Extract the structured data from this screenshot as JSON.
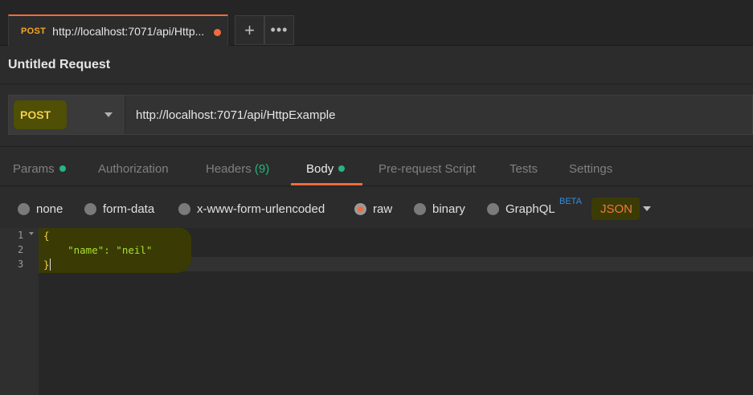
{
  "tab": {
    "method": "POST",
    "title": "http://localhost:7071/api/Http..."
  },
  "request_name": "Untitled Request",
  "url_bar": {
    "method": "POST",
    "url": "http://localhost:7071/api/HttpExample"
  },
  "section_tabs": [
    {
      "label": "Params"
    },
    {
      "label": "Authorization"
    },
    {
      "label": "Headers",
      "count": "(9)"
    },
    {
      "label": "Body"
    },
    {
      "label": "Pre-request Script"
    },
    {
      "label": "Tests"
    },
    {
      "label": "Settings"
    }
  ],
  "body_types": [
    {
      "label": "none"
    },
    {
      "label": "form-data"
    },
    {
      "label": "x-www-form-urlencoded"
    },
    {
      "label": "raw"
    },
    {
      "label": "binary"
    },
    {
      "label": "GraphQL"
    }
  ],
  "graphql_badge": "BETA",
  "raw_format": "JSON",
  "editor": {
    "line_numbers": [
      "1",
      "2",
      "3"
    ],
    "lines": [
      "{",
      "    \"name\": \"neil\"",
      "}"
    ]
  },
  "icons": {
    "new_tab": "plus-icon",
    "more_tabs": "more-horizontal-icon",
    "method_dropdown": "caret-down-icon",
    "unsaved": "unsaved-dot-icon"
  },
  "colors": {
    "accent": "#f26b3a",
    "success_dot": "#26b47f",
    "method_post": "#f0d050",
    "beta": "#2f8de4"
  }
}
